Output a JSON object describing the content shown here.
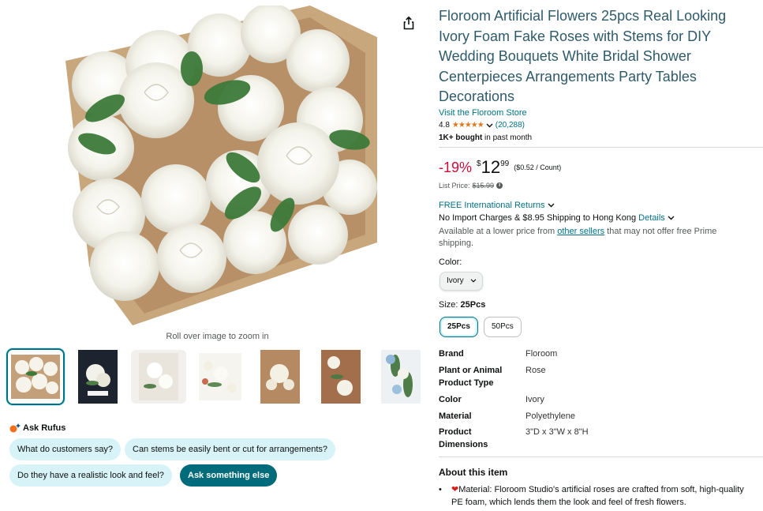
{
  "gallery": {
    "zoom_hint": "Roll over image to zoom in",
    "thumbnails": [
      "thumb-box-roses",
      "thumb-bride-bouquet",
      "thumb-table-roses",
      "thumb-flat-lay-roses",
      "thumb-centerpiece",
      "thumb-roses-closeup",
      "thumb-blue-bouquet"
    ],
    "selected_index": 0
  },
  "rufus": {
    "title": "Ask Rufus",
    "chips": [
      "What do customers say?",
      "Can stems be easily bent or cut for arrangements?",
      "Do they have a realistic look and feel?"
    ],
    "ask_button": "Ask something else"
  },
  "product": {
    "title": "Floroom Artificial Flowers 25pcs Real Looking Ivory Foam Fake Roses with Stems for DIY Wedding Bouquets White Bridal Shower Centerpieces Arrangements Party Tables Decorations",
    "store_link": "Visit the Floroom Store",
    "rating_value": "4.8",
    "stars": "★★★★★",
    "rating_count": "(20,288)",
    "bought_bold": "1K+ bought",
    "bought_rest": " in past month"
  },
  "price": {
    "discount": "-19%",
    "currency": "$",
    "whole": "12",
    "fraction": "99",
    "unit_price": "($0.52 / Count)",
    "list_label": "List Price:",
    "list_value": "$15.99"
  },
  "delivery": {
    "returns": "FREE International Returns",
    "shipping_text": "No Import Charges & $8.95 Shipping to Hong Kong ",
    "shipping_link": "Details",
    "avail_pre": "Available at a lower price from ",
    "avail_link": "other sellers",
    "avail_post": " that may not offer free Prime shipping."
  },
  "variants": {
    "color_label": "Color:",
    "color_value": "Ivory",
    "size_label": "Size:",
    "size_value": "25Pcs",
    "sizes": [
      "25Pcs",
      "50Pcs"
    ]
  },
  "specs": [
    {
      "label": "Brand",
      "value": "Floroom"
    },
    {
      "label": "Plant or Animal Product Type",
      "value": "Rose"
    },
    {
      "label": "Color",
      "value": "Ivory"
    },
    {
      "label": "Material",
      "value": "Polyethylene"
    },
    {
      "label": "Product Dimensions",
      "value": "3\"D x 3\"W x 8\"H"
    }
  ],
  "about": {
    "heading": "About this item",
    "first_bullet": "Material: Floroom Studio's artificial roses are crafted from soft, high-quality PE foam, which lends them the look and feel of fresh flowers."
  },
  "colors": {
    "link": "#007185",
    "title": "#2f5a6a",
    "discount": "#cc0c39",
    "star": "#de7921",
    "chip": "#d8f3f7",
    "chip_dark": "#006b7a"
  }
}
